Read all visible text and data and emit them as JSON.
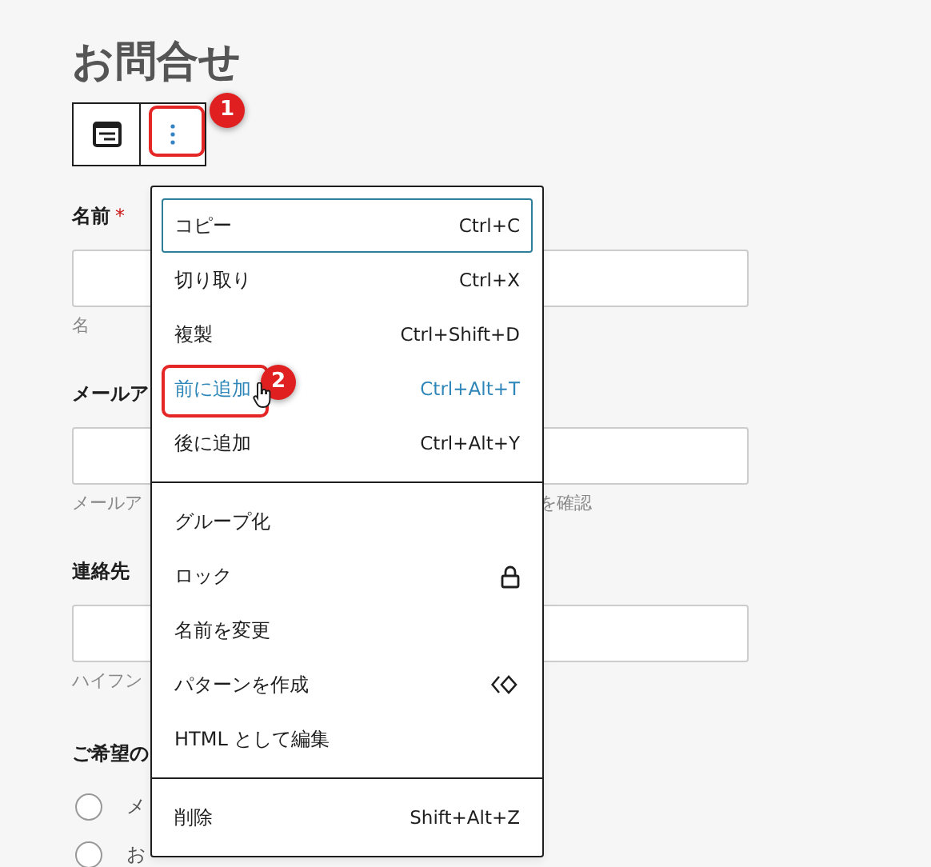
{
  "page": {
    "title": "お問合せ"
  },
  "toolbar": {
    "more_button": {
      "badge": "1"
    }
  },
  "fields": [
    {
      "label": "名前",
      "required_mark": "*",
      "hint": "名"
    },
    {
      "label": "メールア",
      "hint": "メールア",
      "hint_tail": "を確認"
    },
    {
      "label": "連絡先",
      "hint": "ハイフン"
    }
  ],
  "radio_group": {
    "label": "ご希望の",
    "options": [
      {
        "label": "メ",
        "selected": false
      },
      {
        "label": "お",
        "selected": false
      }
    ]
  },
  "menu": {
    "groups": [
      {
        "items": [
          {
            "kind": "shortcut",
            "label": "コピー",
            "shortcut": "Ctrl+C",
            "focused": true,
            "hovered": false
          },
          {
            "kind": "shortcut",
            "label": "切り取り",
            "shortcut": "Ctrl+X",
            "focused": false,
            "hovered": false
          },
          {
            "kind": "shortcut",
            "label": "複製",
            "shortcut": "Ctrl+Shift+D",
            "focused": false,
            "hovered": false
          },
          {
            "kind": "shortcut",
            "label": "前に追加",
            "shortcut": "Ctrl+Alt+T",
            "focused": false,
            "hovered": true,
            "badge": "2"
          },
          {
            "kind": "shortcut",
            "label": "後に追加",
            "shortcut": "Ctrl+Alt+Y",
            "focused": false,
            "hovered": false
          }
        ]
      },
      {
        "items": [
          {
            "kind": "plain",
            "label": "グループ化",
            "focused": false,
            "hovered": false
          },
          {
            "kind": "lock",
            "label": "ロック",
            "focused": false,
            "hovered": false
          },
          {
            "kind": "plain",
            "label": "名前を変更",
            "focused": false,
            "hovered": false
          },
          {
            "kind": "pattern",
            "label": "パターンを作成",
            "focused": false,
            "hovered": false
          },
          {
            "kind": "plain",
            "label": "HTML として編集",
            "focused": false,
            "hovered": false
          }
        ]
      },
      {
        "items": [
          {
            "kind": "shortcut",
            "label": "削除",
            "shortcut": "Shift+Alt+Z",
            "focused": false,
            "hovered": false
          }
        ]
      }
    ]
  }
}
